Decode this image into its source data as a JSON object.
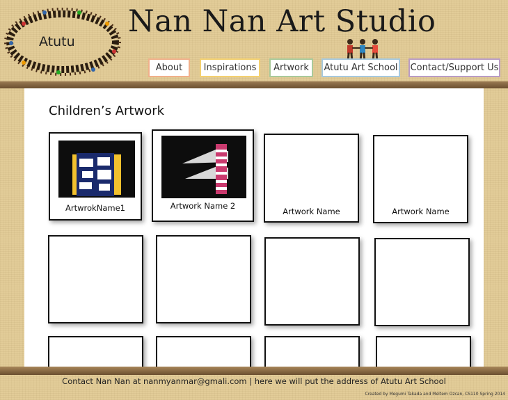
{
  "header": {
    "logo_text": "Atutu",
    "site_title": "Nan Nan Art Studio",
    "nav": [
      {
        "label": "About"
      },
      {
        "label": "Inspirations"
      },
      {
        "label": "Artwork"
      },
      {
        "label": "Atutu Art School"
      },
      {
        "label": "Contact/Support Us"
      }
    ]
  },
  "main": {
    "title": "Children’s Artwork",
    "cards": [
      {
        "label": "ArtwrokName1"
      },
      {
        "label": "Artwork Name 2"
      },
      {
        "label": "Artwork Name"
      },
      {
        "label": "Artwork Name"
      }
    ]
  },
  "footer": {
    "contact": "Contact Nan Nan at nanmyanmar@gmali.com | here we will put the address of Atutu Art School",
    "credit": "Created by Megumi Takada and Meltem Ozcan, CS110 Spring 2014"
  }
}
